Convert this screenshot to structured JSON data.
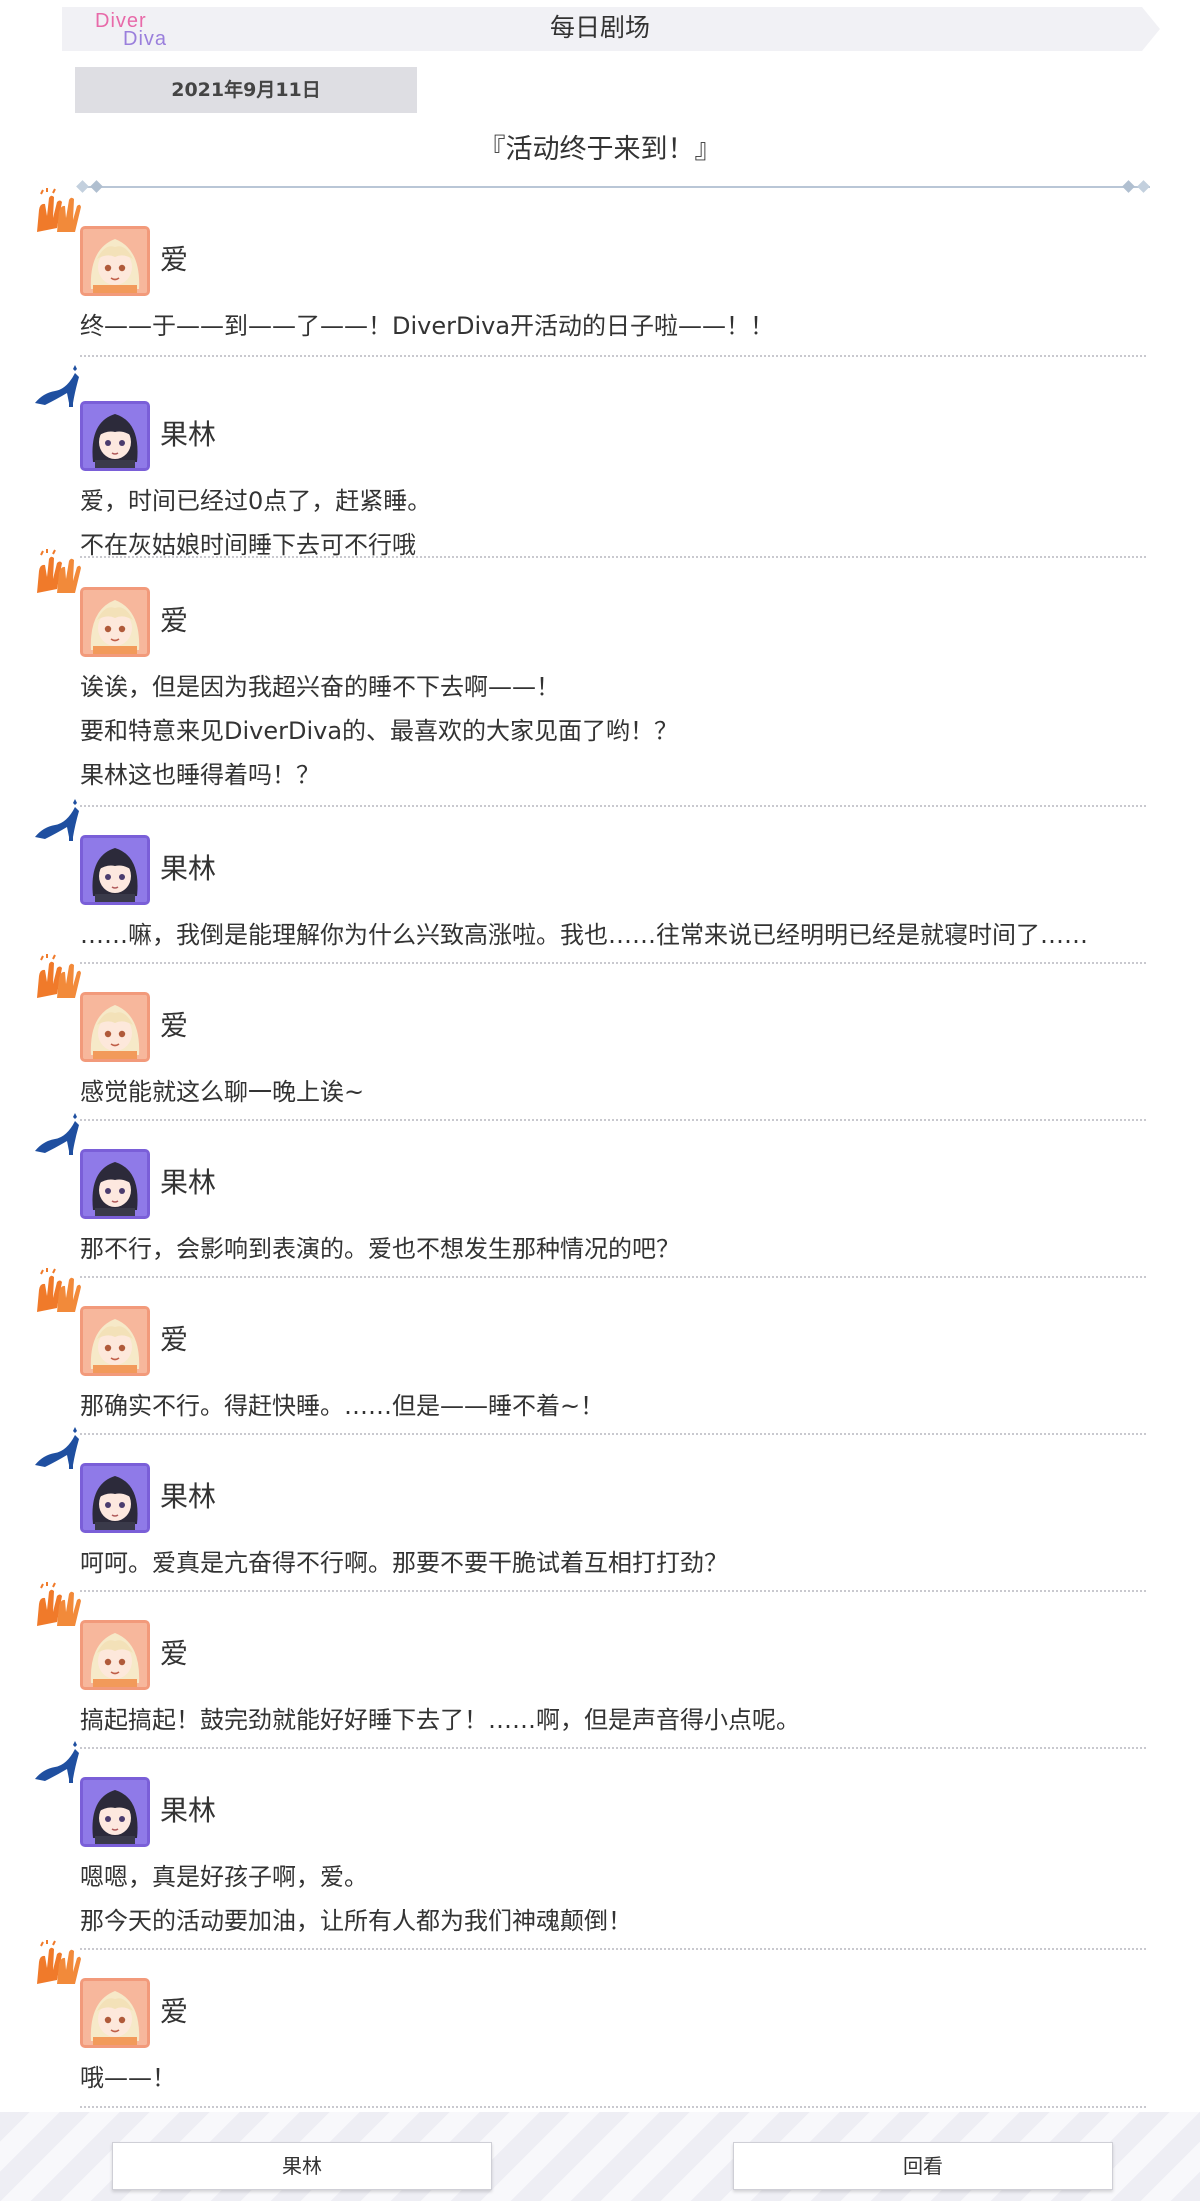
{
  "header": {
    "logo_line1": "Diver",
    "logo_line2": "Diva",
    "title": "每日剧场"
  },
  "date": "2021年9月11日",
  "episode_title": "『活动终于来到！』",
  "characters": {
    "ai": {
      "name": "爱",
      "deco_icon": "cheer-hands-icon",
      "accent": "#f07a2a"
    },
    "karin": {
      "name": "果林",
      "deco_icon": "glass-slipper-icon",
      "accent": "#1f4fa0"
    }
  },
  "messages": [
    {
      "speaker": "爱",
      "lines": [
        "终——于——到——了——！DiverDiva开活动的日子啦——！！"
      ]
    },
    {
      "speaker": "果林",
      "lines": [
        "爱，时间已经过0点了，赶紧睡。",
        "不在灰姑娘时间睡下去可不行哦"
      ]
    },
    {
      "speaker": "爱",
      "lines": [
        "诶诶，但是因为我超兴奋的睡不下去啊——！",
        "要和特意来见DiverDiva的、最喜欢的大家见面了哟！？",
        "果林这也睡得着吗！？"
      ]
    },
    {
      "speaker": "果林",
      "lines": [
        "……嘛，我倒是能理解你为什么兴致高涨啦。我也……往常来说已经明明已经是就寝时间了……"
      ]
    },
    {
      "speaker": "爱",
      "lines": [
        "感觉能就这么聊一晚上诶~"
      ]
    },
    {
      "speaker": "果林",
      "lines": [
        "那不行，会影响到表演的。爱也不想发生那种情况的吧？"
      ]
    },
    {
      "speaker": "爱",
      "lines": [
        "那确实不行。得赶快睡。……但是——睡不着~！"
      ]
    },
    {
      "speaker": "果林",
      "lines": [
        "呵呵。爱真是亢奋得不行啊。那要不要干脆试着互相打打劲？"
      ]
    },
    {
      "speaker": "爱",
      "lines": [
        "搞起搞起！鼓完劲就能好好睡下去了！……啊，但是声音得小点呢。"
      ]
    },
    {
      "speaker": "果林",
      "lines": [
        "嗯嗯，真是好孩子啊，爱。",
        "那今天的活动要加油，让所有人都为我们神魂颠倒！"
      ]
    },
    {
      "speaker": "爱",
      "lines": [
        "哦——！"
      ]
    }
  ],
  "footer": {
    "left_button": "果林",
    "right_button": "回看"
  }
}
